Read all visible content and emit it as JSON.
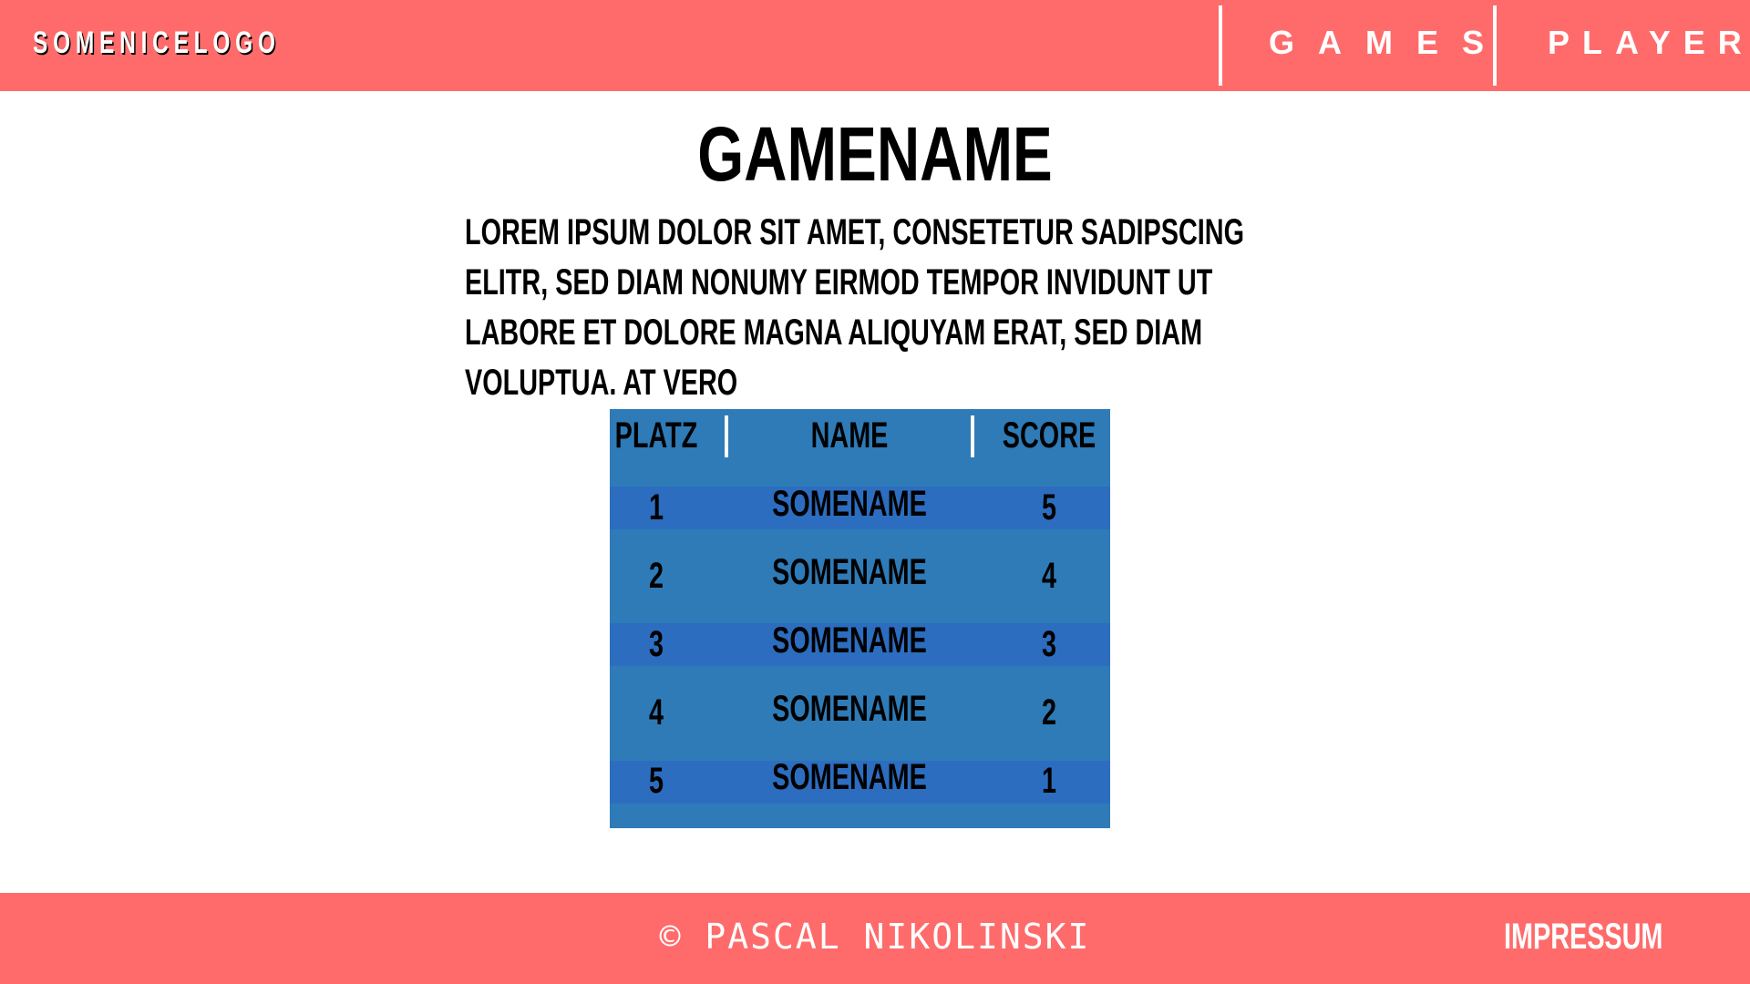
{
  "header": {
    "logo": "SOMENICELOGO",
    "nav": [
      {
        "label": "GAMES"
      },
      {
        "label": "PLAYERS"
      }
    ]
  },
  "main": {
    "title": "GAMENAME",
    "description": "LOREM IPSUM DOLOR SIT AMET, CONSETETUR SADIPSCING ELITR, SED DIAM NONUMY EIRMOD TEMPOR INVIDUNT UT LABORE ET DOLORE MAGNA ALIQUYAM ERAT, SED DIAM VOLUPTUA. AT VERO"
  },
  "leaderboard": {
    "columns": [
      "PLATZ",
      "NAME",
      "SCORE"
    ],
    "rows": [
      {
        "platz": "1",
        "name": "SOMENAME",
        "score": "5"
      },
      {
        "platz": "2",
        "name": "SOMENAME",
        "score": "4"
      },
      {
        "platz": "3",
        "name": "SOMENAME",
        "score": "3"
      },
      {
        "platz": "4",
        "name": "SOMENAME",
        "score": "2"
      },
      {
        "platz": "5",
        "name": "SOMENAME",
        "score": "1"
      }
    ]
  },
  "footer": {
    "copyright": "© PASCAL NIKOLINSKI",
    "impressum": "IMPRESSUM"
  },
  "colors": {
    "brand": "#FF6B6B",
    "table_bg": "#2E7BB8",
    "table_band": "#2C6DC0"
  }
}
